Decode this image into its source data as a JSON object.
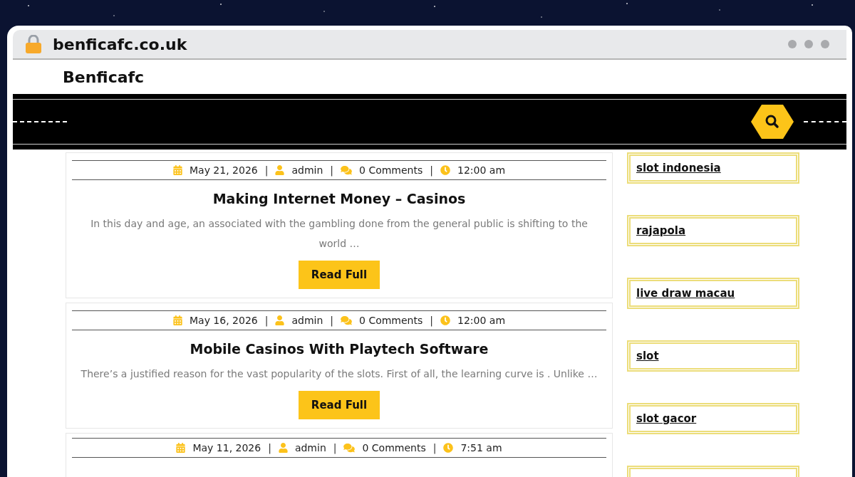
{
  "browser": {
    "url": "benficafc.co.uk"
  },
  "site": {
    "title": "Benficafc"
  },
  "posts": [
    {
      "meta": [
        {
          "kind": "date",
          "text": "May 21, 2026"
        },
        {
          "kind": "separator",
          "text": "|"
        },
        {
          "kind": "author",
          "text": "admin"
        },
        {
          "kind": "separator",
          "text": "|"
        },
        {
          "kind": "comments",
          "text": "0 Comments"
        },
        {
          "kind": "separator",
          "text": "|"
        },
        {
          "kind": "time",
          "text": "12:00 am"
        }
      ],
      "title": "Making Internet Money – Casinos",
      "excerpt": "In this day and age, an associated with the gambling done from the general public is shifting to the world …",
      "button": "Read Full"
    },
    {
      "meta": [
        {
          "kind": "date",
          "text": "May 16, 2026"
        },
        {
          "kind": "separator",
          "text": "|"
        },
        {
          "kind": "author",
          "text": "admin"
        },
        {
          "kind": "separator",
          "text": "|"
        },
        {
          "kind": "comments",
          "text": "0 Comments"
        },
        {
          "kind": "separator",
          "text": "|"
        },
        {
          "kind": "time",
          "text": "12:00 am"
        }
      ],
      "title": "Mobile Casinos With Playtech Software",
      "excerpt": "There’s a justified reason for the vast popularity of the slots. First of all, the learning curve is . Unlike …",
      "button": "Read Full"
    },
    {
      "meta": [
        {
          "kind": "date",
          "text": "May 11, 2026"
        },
        {
          "kind": "separator",
          "text": "|"
        },
        {
          "kind": "author",
          "text": "admin"
        },
        {
          "kind": "separator",
          "text": "|"
        },
        {
          "kind": "comments",
          "text": "0 Comments"
        },
        {
          "kind": "separator",
          "text": "|"
        },
        {
          "kind": "time",
          "text": "7:51 am"
        }
      ]
    }
  ],
  "sidebar": {
    "links": [
      "slot indonesia",
      "rajapola",
      "live draw macau",
      "slot",
      "slot gacor"
    ]
  }
}
